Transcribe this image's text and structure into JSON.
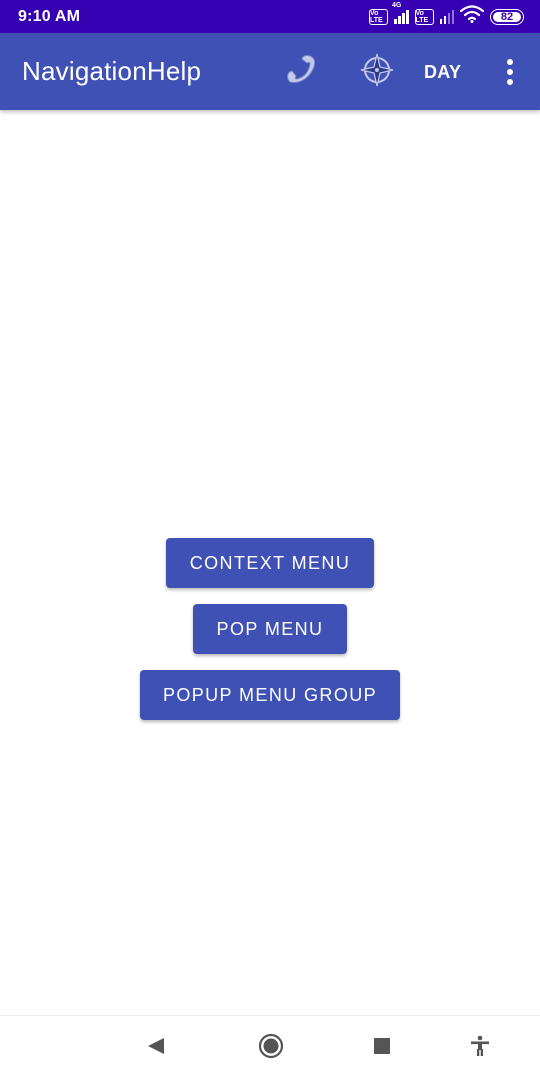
{
  "status_bar": {
    "time": "9:10 AM",
    "volte1": "Vo LTE",
    "network_type": "4G",
    "volte2": "Vo LTE",
    "battery": "82",
    "icons": [
      "volte-icon",
      "signal-icon",
      "volte-icon",
      "signal-icon",
      "wifi-icon",
      "battery-icon"
    ]
  },
  "app_bar": {
    "title": "NavigationHelp",
    "actions": {
      "phone_icon": "phone-icon",
      "compass_icon": "compass-icon",
      "day_label": "DAY",
      "overflow_icon": "more-vert-icon"
    }
  },
  "buttons": {
    "context_menu": "CONTEXT MENU",
    "pop_menu": "POP MENU",
    "popup_menu_group": "POPUP MENU GROUP"
  },
  "nav_bar": {
    "icons": [
      "back-icon",
      "home-icon",
      "recents-icon",
      "accessibility-icon"
    ]
  },
  "colors": {
    "status_bar": "#3700b3",
    "primary": "#3f51b5",
    "on_primary": "#ffffff",
    "background": "#ffffff",
    "nav_icon": "#555555"
  }
}
